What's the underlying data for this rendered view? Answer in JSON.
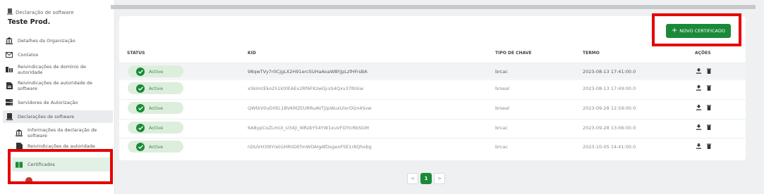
{
  "sidebar": {
    "breadcrumb": "Declaração de software",
    "app_name": "Teste Prod.",
    "items": [
      {
        "label": "Detalhes da Organização",
        "icon": "bank-icon"
      },
      {
        "label": "Contatos",
        "icon": "mail-icon"
      },
      {
        "label": "Reivindicações de domínio de autoridade",
        "icon": "domain-claims-icon"
      },
      {
        "label": "Reivindicações de autoridade de software",
        "icon": "document-icon"
      },
      {
        "label": "Servidores de Autorização",
        "icon": "server-icon"
      },
      {
        "label": "Declarações de software",
        "icon": "software-statement-icon"
      }
    ],
    "sub_items": [
      {
        "label": "Informações da declaração de software",
        "icon": "bank-icon"
      },
      {
        "label": "Reivindicações de autoridade",
        "icon": "document-icon"
      },
      {
        "label": "Certificados",
        "icon": "certificate-icon"
      }
    ]
  },
  "toolbar": {
    "new_certificate_label": "NOVO CERTIFICADO"
  },
  "table": {
    "columns": [
      "STATUS",
      "KID",
      "TIPO DE CHAVE",
      "TERMO",
      "AÇÕES"
    ],
    "rows": [
      {
        "status": "Active",
        "kid": "98qwTVy7r0CjgLX2H91ercSUHaAoaWBYJpLzfHFrsBA",
        "tipo": "brcac",
        "termo": "2023-08-13 17:41:00.0"
      },
      {
        "status": "Active",
        "kid": "xSkimtEko251kt0EAEx2Rf6FKzwGJ-sS4Qxv37lbSiw",
        "tipo": "brseal",
        "termo": "2023-08-13 17:49:00.0"
      },
      {
        "status": "Active",
        "kid": "QWtkV0uD0EL1BVKMZEURRuAVTJipWuxUlxrOlzn4Svw",
        "tipo": "brseal",
        "termo": "2023-09-28 12:59:00.0"
      },
      {
        "status": "Active",
        "kid": "6A8ypCoZLmUI_U34ji_I9RzbY54YW1xuVFGYlcRbSGM",
        "tipo": "brcac",
        "termo": "2023-09-28 13:06:00.0"
      },
      {
        "status": "Active",
        "kid": "nDUVH3l9YretGHR0DEfmWDAlgAfDsgenFSE1r8Qhobg",
        "tipo": "brcac",
        "termo": "2023-10-05 14:41:00.0"
      }
    ]
  },
  "pagination": {
    "prev": "<",
    "current": "1",
    "next": ">"
  },
  "colors": {
    "accent": "#1a8a38",
    "highlight_frame": "#e60000"
  }
}
